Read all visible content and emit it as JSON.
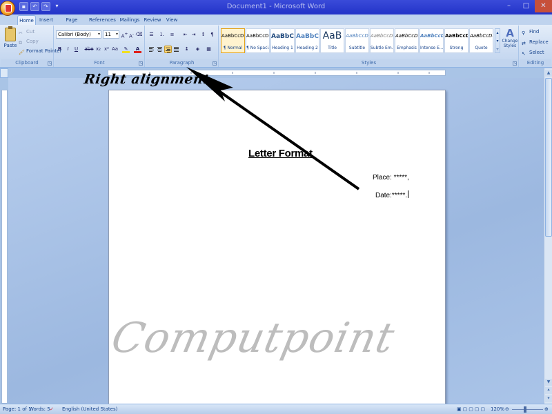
{
  "window": {
    "title": "Document1 - Microsoft Word",
    "controls": [
      "–",
      "□",
      "✕"
    ]
  },
  "quick_access": [
    "save-icon",
    "undo-icon",
    "redo-icon"
  ],
  "tabs": [
    {
      "label": "Home",
      "active": true
    },
    {
      "label": "Insert"
    },
    {
      "label": "Page Layout"
    },
    {
      "label": "References"
    },
    {
      "label": "Mailings"
    },
    {
      "label": "Review"
    },
    {
      "label": "View"
    }
  ],
  "ribbon": {
    "clipboard": {
      "label": "Clipboard",
      "paste": "Paste",
      "cut": "Cut",
      "copy": "Copy",
      "format_painter": "Format Painter"
    },
    "font": {
      "label": "Font",
      "family": "Calibri (Body)",
      "size": "11",
      "buttons": [
        "B",
        "I",
        "U",
        "abe",
        "x₂",
        "x²",
        "Aa"
      ]
    },
    "paragraph": {
      "label": "Paragraph",
      "active_alignment": "right"
    },
    "styles": {
      "label": "Styles",
      "tiles": [
        {
          "sample": "AaBbCcDc",
          "name": "¶ Normal"
        },
        {
          "sample": "AaBbCcDc",
          "name": "¶ No Spaci..."
        },
        {
          "sample": "AaBbCc",
          "name": "Heading 1"
        },
        {
          "sample": "AaBbCc",
          "name": "Heading 2"
        },
        {
          "sample": "AaB",
          "name": "Title"
        },
        {
          "sample": "AaBbCcD",
          "name": "Subtitle"
        },
        {
          "sample": "AaBbCcDc",
          "name": "Subtle Em..."
        },
        {
          "sample": "AaBbCcDc",
          "name": "Emphasis"
        },
        {
          "sample": "AaBbCcDc",
          "name": "Intense E..."
        },
        {
          "sample": "AaBbCcDc",
          "name": "Strong"
        },
        {
          "sample": "AaBbCcDc",
          "name": "Quote"
        }
      ],
      "change_styles": "Change Styles"
    },
    "editing": {
      "label": "Editing",
      "find": "Find",
      "replace": "Replace",
      "select": "Select"
    }
  },
  "document": {
    "title": "Letter Format",
    "place": "Place: *****,",
    "date": "Date:*****."
  },
  "annotation": "Right alignment",
  "watermark": "Computpoint",
  "status": {
    "page": "Page: 1 of 1",
    "words": "Words: 5",
    "language": "English (United States)",
    "zoom": "120%"
  }
}
